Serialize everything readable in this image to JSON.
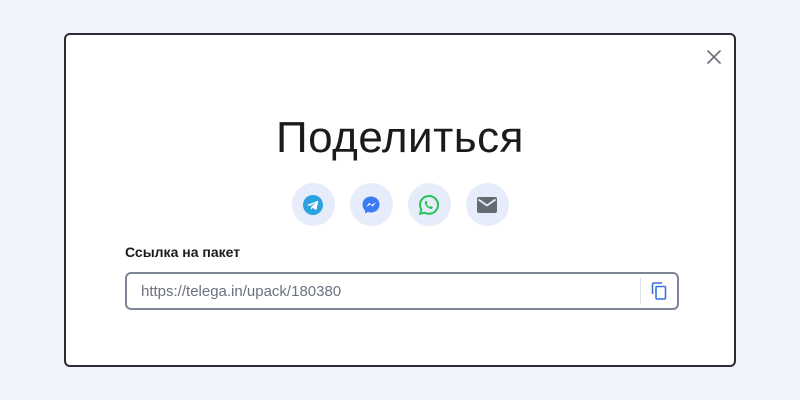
{
  "modal": {
    "title": "Поделиться",
    "close_icon": "close-icon"
  },
  "share_buttons": [
    {
      "name": "telegram",
      "icon": "telegram-icon",
      "color": "#2aa3e0"
    },
    {
      "name": "messenger",
      "icon": "messenger-icon",
      "color": "#3b7cf5"
    },
    {
      "name": "whatsapp",
      "icon": "whatsapp-icon",
      "color": "#25c45a"
    },
    {
      "name": "email",
      "icon": "mail-icon",
      "color": "#666a73"
    }
  ],
  "link": {
    "label": "Ссылка на пакет",
    "value": "https://telega.in/upack/180380",
    "copy_icon": "copy-icon",
    "copy_color": "#3c6fe0"
  },
  "colors": {
    "background": "#eff3fb",
    "modal_border": "#2b2d31",
    "share_bg": "#e6ecf9",
    "input_border": "#7e8597"
  }
}
